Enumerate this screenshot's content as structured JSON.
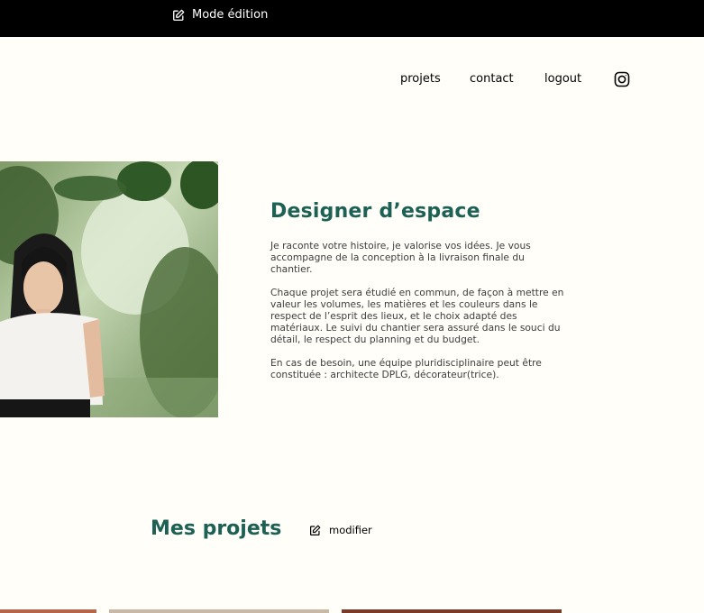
{
  "edit_bar": {
    "label": "Mode édition"
  },
  "nav": {
    "items": [
      {
        "label": "projets"
      },
      {
        "label": "contact"
      },
      {
        "label": "logout"
      }
    ],
    "instagram_icon": "instagram-icon"
  },
  "intro": {
    "title": "Designer d’espace",
    "paragraphs": [
      "Je raconte votre histoire, je valorise vos idées. Je vous accompagne de la conception à la livraison finale du chantier.",
      "Chaque projet sera étudié en commun, de façon à mettre en valeur les volumes, les matières et les couleurs dans le respect de l’esprit des lieux, et le choix adapté des matériaux. Le suivi du chantier sera assuré dans le souci du détail, le respect du planning et du budget.",
      "En cas de besoin, une équipe pluridisciplinaire peut être constituée : architecte DPLG, décorateur(trice)."
    ]
  },
  "projects": {
    "title": "Mes projets",
    "edit_label": "modifier"
  },
  "colors": {
    "background": "#FFFEF8",
    "accent": "#1D6154",
    "edit_bar": "#000000",
    "text": "#3D3D3D"
  }
}
